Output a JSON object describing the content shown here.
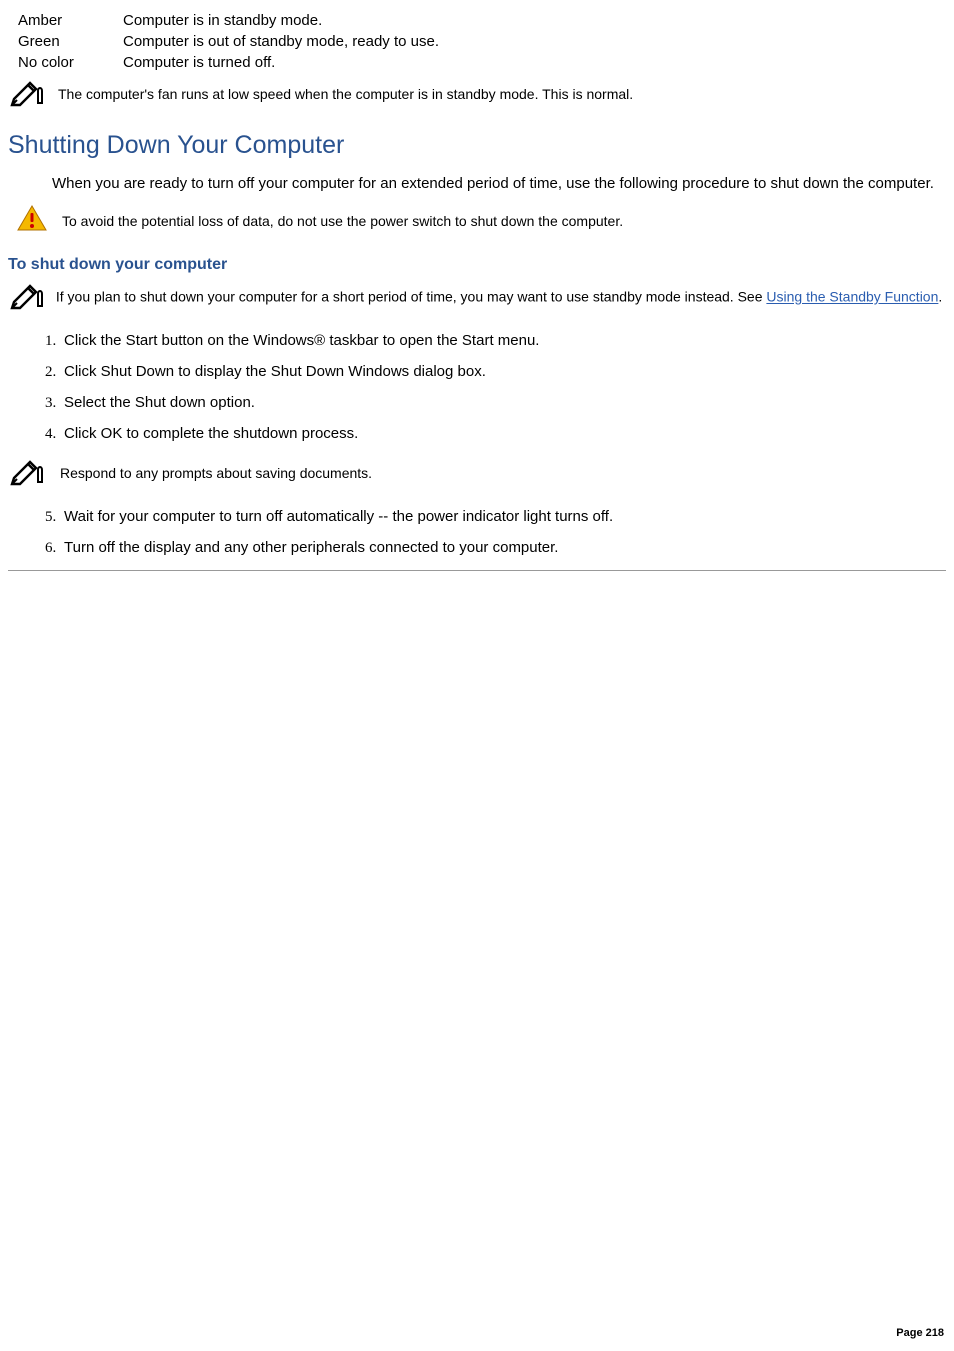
{
  "status_table": {
    "rows": [
      {
        "label": "Amber",
        "desc": "Computer is in standby mode."
      },
      {
        "label": "Green",
        "desc": "Computer is out of standby mode, ready to use."
      },
      {
        "label": "No color",
        "desc": "Computer is turned off."
      }
    ]
  },
  "notes": {
    "fan": "The computer's fan runs at low speed when the computer is in standby mode. This is normal.",
    "warn": "To avoid the potential loss of data, do not use the power switch to shut down the computer.",
    "standby_pre": "If you plan to shut down your computer for a short period of time, you may want to use standby mode instead. See ",
    "standby_link": "Using the Standby Function",
    "standby_post": ".",
    "respond": "Respond to any prompts about saving documents."
  },
  "headings": {
    "shutdown": "Shutting Down Your Computer",
    "to_shutdown": "To shut down your computer"
  },
  "paragraphs": {
    "shutdown_intro": "When you are ready to turn off your computer for an extended period of time, use the following procedure to shut down the computer."
  },
  "steps": [
    "Click the Start button on the Windows® taskbar to open the Start menu.",
    "Click Shut Down to display the Shut Down Windows dialog box.",
    "Select the Shut down option.",
    "Click OK to complete the shutdown process.",
    "Wait for your computer to turn off automatically -- the power indicator light turns off.",
    "Turn off the display and any other peripherals connected to your computer."
  ],
  "footer": {
    "page": "Page 218"
  }
}
